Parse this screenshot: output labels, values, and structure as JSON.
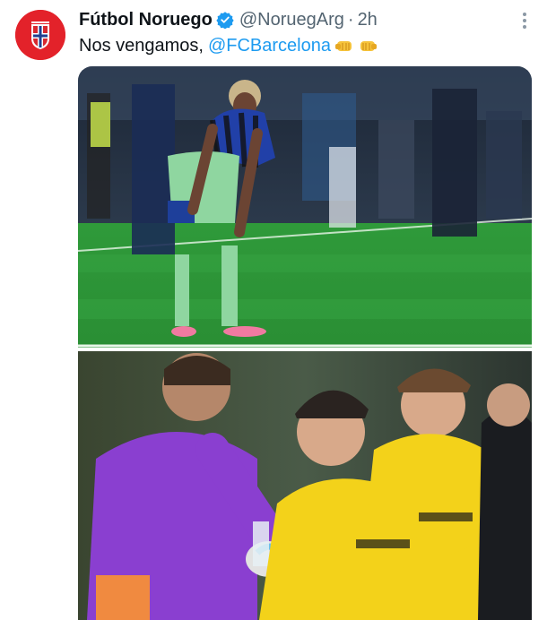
{
  "tweet": {
    "author": {
      "display_name": "Fútbol Noruego",
      "handle": "@NoruegArg",
      "separator": "·",
      "time": "2h",
      "avatar_icon": "norway-flag-badge-icon",
      "verified_icon": "verified-badge-icon"
    },
    "text": {
      "prefix": "Nos vengamos,",
      "mention": "@FCBarcelona",
      "emojis": [
        "left-facing-fist-emoji",
        "right-facing-fist-emoji"
      ]
    },
    "more_icon": "more-options-icon",
    "media": [
      {
        "kind": "photo",
        "subject": "player-blue-black-kit-number-19"
      },
      {
        "kind": "photo",
        "subject": "players-yellow-kits-celebrating"
      }
    ]
  },
  "colors": {
    "accent": "#1d9bf0",
    "avatar_red": "#e3222a",
    "secondary_text": "#536471",
    "pitch_green": "#2f9a3a",
    "kit_yellow": "#f3d21a",
    "kit_purple": "#8a3fd0"
  }
}
